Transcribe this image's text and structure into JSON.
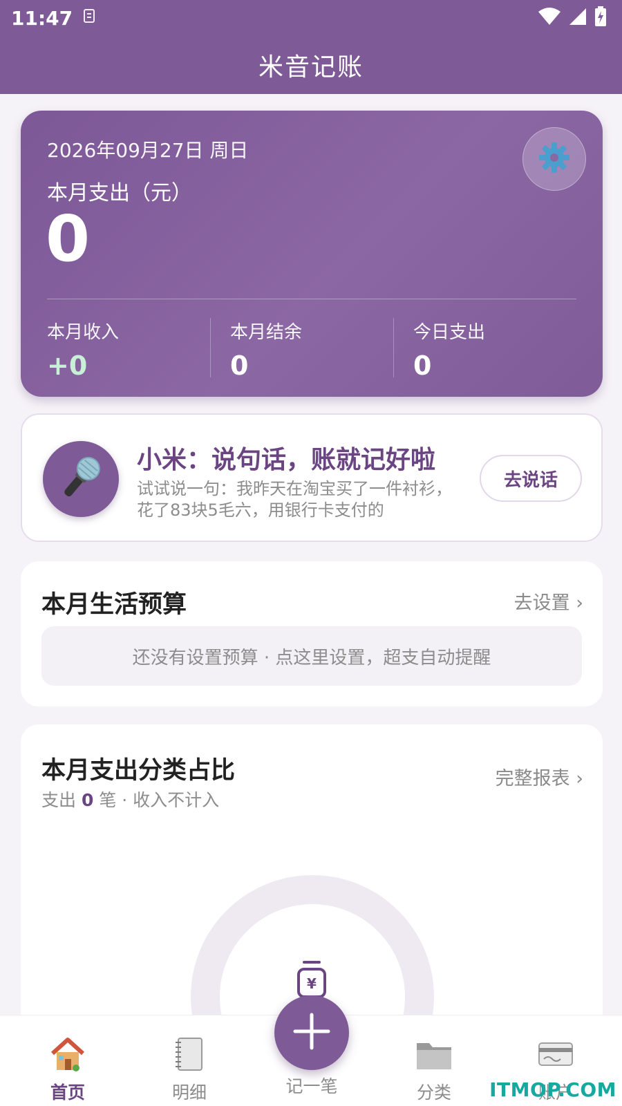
{
  "status_bar": {
    "time": "11:47"
  },
  "app": {
    "title": "米音记账"
  },
  "summary": {
    "date": "2026年09月27日 周日",
    "month_expense_label": "本月支出（元）",
    "month_expense_value": "0",
    "stats": [
      {
        "label": "本月收入",
        "value": "+0"
      },
      {
        "label": "本月结余",
        "value": "0"
      },
      {
        "label": "今日支出",
        "value": "0"
      }
    ]
  },
  "voice_card": {
    "title": "小米：说句话，账就记好啦",
    "description": "试试说一句：我昨天在淘宝买了一件衬衫，花了83块5毛六，用银行卡支付的",
    "button": "去说话"
  },
  "budget_card": {
    "title": "本月生活预算",
    "link": "去设置 ›",
    "empty_text": "还没有设置预算 · 点这里设置，超支自动提醒"
  },
  "category_card": {
    "title": "本月支出分类占比",
    "link": "完整报表 ›",
    "sub_prefix": "支出",
    "sub_count": "0",
    "sub_suffix": "笔 · 收入不计入"
  },
  "bottom_nav": {
    "items": [
      {
        "label": "首页",
        "icon": "house-icon",
        "active": true
      },
      {
        "label": "明细",
        "icon": "notebook-icon",
        "active": false
      },
      {
        "label": "记一笔",
        "icon": "plus-icon",
        "active": false
      },
      {
        "label": "分类",
        "icon": "folder-icon",
        "active": false
      },
      {
        "label": "账户",
        "icon": "card-icon",
        "active": false
      }
    ]
  },
  "watermark": "ITMOP.COM",
  "colors": {
    "primary": "#7e5a96",
    "accent_text": "#6a4582",
    "income": "#c8f0d6",
    "background": "#f6f3f8"
  }
}
